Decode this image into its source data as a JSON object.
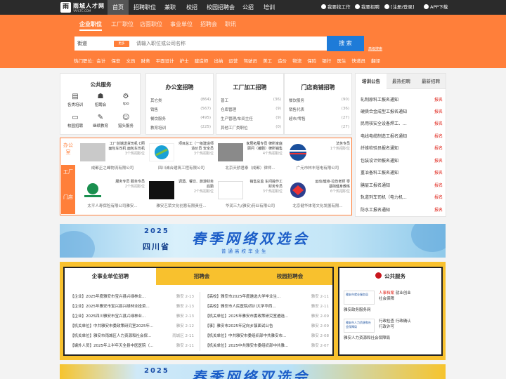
{
  "topbar": {
    "logo_name": "雨城人才网",
    "logo_url": "YAYCFC.COM",
    "nav": [
      "首页",
      "招聘职位",
      "兼职",
      "校招",
      "校园招聘会",
      "公招",
      "培训"
    ],
    "right": [
      "我要找工作",
      "我要招聘",
      "[注册/登录]",
      "APP下载"
    ]
  },
  "search": {
    "tabs": [
      "企业职位",
      "工厂职位",
      "店面职位",
      "事业单位",
      "招聘会",
      "职讯"
    ],
    "city": "街道",
    "city_btn": "更多",
    "placeholder": "请输入职位或公司名称",
    "button": "搜 索",
    "advanced": "高级搜索",
    "hot_label": "热门职位:",
    "hot": [
      "会计",
      "保安",
      "文员",
      "财务",
      "平面设计",
      "护士",
      "建造师",
      "出纳",
      "运营",
      "驾驶员",
      "美工",
      "造价",
      "物流",
      "保险",
      "银行",
      "医生",
      "快递员",
      "翻译"
    ]
  },
  "public_service": {
    "title": "公共服务",
    "items": [
      {
        "label": "各类培训",
        "icon": "book-icon"
      },
      {
        "label": "招聘会",
        "icon": "people-icon"
      },
      {
        "label": "rpo",
        "icon": "gear-icon"
      },
      {
        "label": "校园招聘",
        "icon": "monitor-icon"
      },
      {
        "label": "继续教育",
        "icon": "pen-icon"
      },
      {
        "label": "猎头服务",
        "icon": "user-icon"
      }
    ]
  },
  "categories": [
    {
      "title": "办公室招聘",
      "rows": [
        [
          "其它类",
          "(864)"
        ],
        [
          "销售",
          "(567)"
        ],
        [
          "餐饮服务",
          "(495)"
        ],
        [
          "教育培训",
          "(225)"
        ]
      ]
    },
    {
      "title": "工厂加工招聘",
      "rows": [
        [
          "普工",
          "(36)"
        ],
        [
          "仓库管理",
          "(9)"
        ],
        [
          "生产管理/车间主任",
          "(9)"
        ],
        [
          "其他工厂类职位",
          "(0)"
        ]
      ]
    },
    {
      "title": "门店商铺招聘",
      "rows": [
        [
          "餐饮服务",
          "(90)"
        ],
        [
          "销售代表",
          "(36)"
        ],
        [
          "超市/零售",
          "(27)"
        ],
        [
          "",
          "(27)"
        ]
      ]
    }
  ],
  "side": {
    "tabs": [
      "培训公告",
      "最热招聘",
      "最新招聘"
    ],
    "badge": "报名",
    "rows": [
      "轧制原料工报名通知",
      "硬质合金成型工报名通知",
      "民用核安全设备焊工、...",
      "电线电缆制造工报名通知",
      "纤维检验员报名通知",
      "包装设计师报名通知",
      "重冶备料工报名通知",
      "膳层工报名通知",
      "轨道列车司机（电力机...",
      "防水工报名通知"
    ]
  },
  "company": {
    "side_labels": [
      "办公室",
      "工厂",
      "门店"
    ],
    "items": [
      {
        "desc": "工厂前端送货司机 C照面包车司机 面包车司机",
        "count": "3个热招职位",
        "name": "成都正之峰物流有限公司"
      },
      {
        "desc": "项目总工（一级建造师 造价员 安全员",
        "count": "3个热招职位",
        "name": "四川诚合建筑工程有限公司"
      },
      {
        "desc": "家居拓展专员 律所家庭顾问（编剧）律所销售",
        "count": "4个热招职位",
        "name": "北京天骄君泰（成都）律师..."
      },
      {
        "desc": "法务专员",
        "count": "1个热招职位",
        "name": "广元市林丰冠电有限公司"
      },
      {
        "desc": "服务专员 服务专员",
        "count": "2个热招职位",
        "name": "太平人寿保险有限公司雅安..."
      },
      {
        "desc": "调酒、餐饮、旅游财务后勤",
        "count": "2个热招职位",
        "name": "雅安艺荣文化创意有限责任..."
      },
      {
        "desc": "销售总监 车间操作工 财务专员",
        "count": "3个热招职位",
        "name": "华润三九(雅安)药业有限公司"
      },
      {
        "desc": "运动/健身·拉伤老师 零基础健身教练",
        "count": "6个热招职位",
        "name": "北京健华体育文化发展有限..."
      }
    ]
  },
  "banner": {
    "year": "2025",
    "province": "四川省",
    "title": "春季网络双选会",
    "subtitle": "普通高校毕业生"
  },
  "lower": {
    "tabs": [
      "企事业单位招聘",
      "招聘会",
      "校园招聘会"
    ],
    "left_news": [
      {
        "t": "【企业】2025年度雅安市宝兴县兴绿林业...",
        "src": "雅安",
        "d": "2-13"
      },
      {
        "t": "【企业】2025年雅安市宝兴县兴绿林业投资...",
        "src": "雅安",
        "d": "2-13"
      },
      {
        "t": "【企业】2025四川雅安市宝兴县兴绿林业...",
        "src": "雅安",
        "d": "2-13"
      },
      {
        "t": "【机关单位】中共雅安市委政策研究室2025年...",
        "src": "雅安",
        "d": "2-12"
      },
      {
        "t": "【机关单位】雅安市雨城区人力资源和社会保...",
        "src": "雨城区",
        "d": "2-11"
      },
      {
        "t": "【编外人员】2025年上半年天全县中医医院（...",
        "src": "雅安",
        "d": "2-11"
      }
    ],
    "right_news": [
      {
        "t": "【高校】雅安市2025年度遴选大学毕业生...",
        "src": "雅安",
        "d": "2-11"
      },
      {
        "t": "【高校】雅安市人民医院/四川大学华西...",
        "src": "雅安",
        "d": "2-11"
      },
      {
        "t": "【机关单位】2025年雅安市委政策研究室遴选...",
        "src": "雅安",
        "d": "2-09"
      },
      {
        "t": "【事】雅安市2025年定向乡镇面试公告",
        "src": "雅安",
        "d": "2-09"
      },
      {
        "t": "【机关单位】中共雅安市委组织部中共雅安市...",
        "src": "雅安",
        "d": "2-08"
      },
      {
        "t": "【机关单位】2025中共雅安市委组织部中共雅...",
        "src": "雅安",
        "d": "2-07"
      }
    ]
  },
  "pub": {
    "title": "公共服务",
    "rows": [
      {
        "org": "雅安市就业服务局",
        "tags": [
          "人事档案",
          "就业创业",
          "社会保障"
        ],
        "foot": "雅安政务服务网"
      },
      {
        "org": "雅安市人力资源和社会保障局",
        "tags": [
          "行政检查",
          "行政确认",
          "行政许可"
        ],
        "foot": "雅安人力资源和社会保障局"
      }
    ]
  },
  "colors": {
    "brand": "#ff7f3a",
    "accent": "#1e7bd8",
    "yellow": "#f8c12e"
  }
}
